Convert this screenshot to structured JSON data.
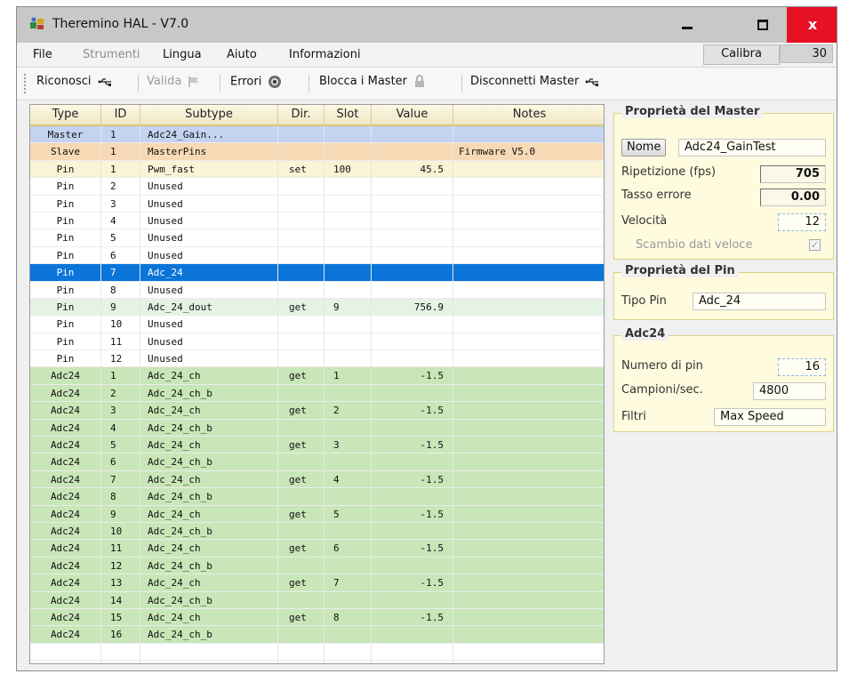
{
  "window": {
    "title": "Theremino HAL - V7.0",
    "close_label": "x"
  },
  "menu": {
    "file": "File",
    "strumenti": "Strumenti",
    "lingua": "Lingua",
    "aiuto": "Aiuto",
    "informazioni": "Informazioni"
  },
  "calibra": {
    "label": "Calibra",
    "value": "30"
  },
  "toolbar": {
    "riconosci": "Riconosci",
    "valida": "Valida",
    "errori": "Errori",
    "blocca": "Blocca i Master",
    "disconnetti": "Disconnetti Master"
  },
  "grid": {
    "headers": [
      "Type",
      "ID",
      "Subtype",
      "Dir.",
      "Slot",
      "Value",
      "Notes"
    ],
    "rows": [
      [
        "Master",
        "1",
        "Adc24_Gain...",
        "",
        "",
        "",
        ""
      ],
      [
        "Slave",
        "1",
        "MasterPins",
        "",
        "",
        "",
        "Firmware V5.0"
      ],
      [
        "Pin",
        "1",
        "Pwm_fast",
        "set",
        "100",
        "45.5",
        ""
      ],
      [
        "Pin",
        "2",
        "Unused",
        "",
        "",
        "",
        ""
      ],
      [
        "Pin",
        "3",
        "Unused",
        "",
        "",
        "",
        ""
      ],
      [
        "Pin",
        "4",
        "Unused",
        "",
        "",
        "",
        ""
      ],
      [
        "Pin",
        "5",
        "Unused",
        "",
        "",
        "",
        ""
      ],
      [
        "Pin",
        "6",
        "Unused",
        "",
        "",
        "",
        ""
      ],
      [
        "Pin",
        "7",
        "Adc_24",
        "",
        "",
        "",
        ""
      ],
      [
        "Pin",
        "8",
        "Unused",
        "",
        "",
        "",
        ""
      ],
      [
        "Pin",
        "9",
        "Adc_24_dout",
        "get",
        "9",
        "756.9",
        ""
      ],
      [
        "Pin",
        "10",
        "Unused",
        "",
        "",
        "",
        ""
      ],
      [
        "Pin",
        "11",
        "Unused",
        "",
        "",
        "",
        ""
      ],
      [
        "Pin",
        "12",
        "Unused",
        "",
        "",
        "",
        ""
      ],
      [
        "Adc24",
        "1",
        "Adc_24_ch",
        "get",
        "1",
        "-1.5",
        ""
      ],
      [
        "Adc24",
        "2",
        "Adc_24_ch_b",
        "",
        "",
        "",
        ""
      ],
      [
        "Adc24",
        "3",
        "Adc_24_ch",
        "get",
        "2",
        "-1.5",
        ""
      ],
      [
        "Adc24",
        "4",
        "Adc_24_ch_b",
        "",
        "",
        "",
        ""
      ],
      [
        "Adc24",
        "5",
        "Adc_24_ch",
        "get",
        "3",
        "-1.5",
        ""
      ],
      [
        "Adc24",
        "6",
        "Adc_24_ch_b",
        "",
        "",
        "",
        ""
      ],
      [
        "Adc24",
        "7",
        "Adc_24_ch",
        "get",
        "4",
        "-1.5",
        ""
      ],
      [
        "Adc24",
        "8",
        "Adc_24_ch_b",
        "",
        "",
        "",
        ""
      ],
      [
        "Adc24",
        "9",
        "Adc_24_ch",
        "get",
        "5",
        "-1.5",
        ""
      ],
      [
        "Adc24",
        "10",
        "Adc_24_ch_b",
        "",
        "",
        "",
        ""
      ],
      [
        "Adc24",
        "11",
        "Adc_24_ch",
        "get",
        "6",
        "-1.5",
        ""
      ],
      [
        "Adc24",
        "12",
        "Adc_24_ch_b",
        "",
        "",
        "",
        ""
      ],
      [
        "Adc24",
        "13",
        "Adc_24_ch",
        "get",
        "7",
        "-1.5",
        ""
      ],
      [
        "Adc24",
        "14",
        "Adc_24_ch_b",
        "",
        "",
        "",
        ""
      ],
      [
        "Adc24",
        "15",
        "Adc_24_ch",
        "get",
        "8",
        "-1.5",
        ""
      ],
      [
        "Adc24",
        "16",
        "Adc_24_ch_b",
        "",
        "",
        "",
        ""
      ]
    ],
    "row_styles": [
      "master",
      "slave",
      "pinfirst",
      "pin",
      "pin",
      "pin",
      "pin",
      "pin",
      "pinsel",
      "pin",
      "pinget",
      "pin",
      "pin",
      "pin",
      "adc",
      "adc",
      "adc",
      "adc",
      "adc",
      "adc",
      "adc",
      "adc",
      "adc",
      "adc",
      "adc",
      "adc",
      "adc",
      "adc",
      "adc",
      "adc"
    ]
  },
  "master_props": {
    "title": "Proprietà del Master",
    "nome_button": "Nome",
    "nome_value": "Adc24_GainTest",
    "ripetizione_label": "Ripetizione (fps)",
    "ripetizione_value": "705",
    "errore_label": "Tasso errore",
    "errore_value": "0.00",
    "velocita_label": "Velocità",
    "velocita_value": "12",
    "scambio_label": "Scambio dati veloce",
    "scambio_checked": true
  },
  "pin_props": {
    "title": "Proprietà del Pin",
    "tipo_label": "Tipo Pin",
    "tipo_value": "Adc_24"
  },
  "adc_props": {
    "title": "Adc24",
    "numero_label": "Numero di pin",
    "numero_value": "16",
    "campioni_label": "Campioni/sec.",
    "campioni_value": "4800",
    "filtri_label": "Filtri",
    "filtri_value": "Max Speed"
  }
}
